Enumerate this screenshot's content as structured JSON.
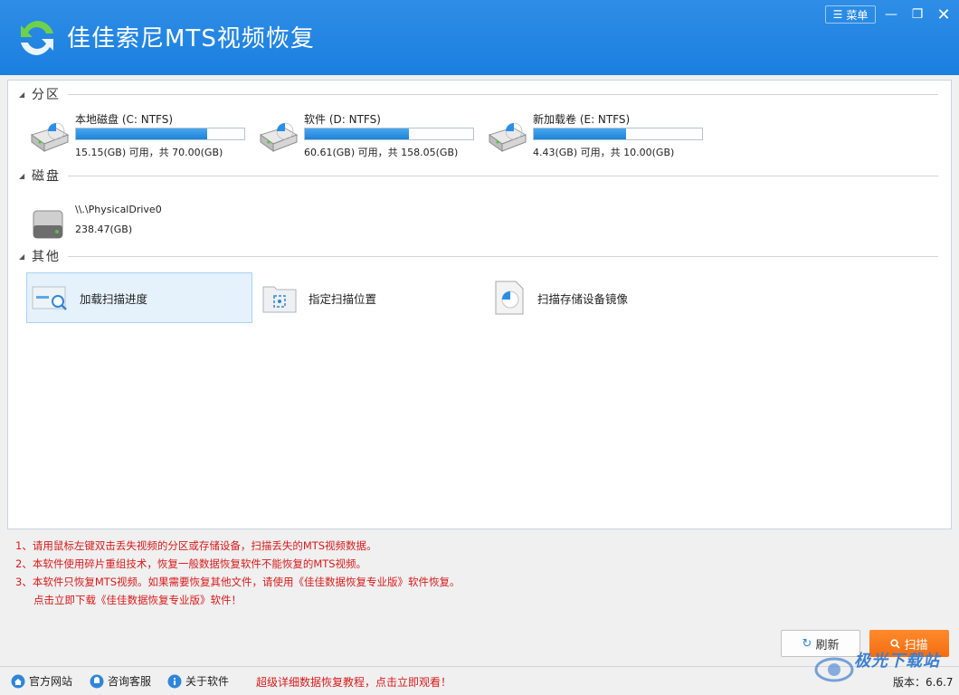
{
  "app": {
    "title": "佳佳索尼MTS视频恢复",
    "menu_label": "菜单",
    "accent": "#1b7fe0"
  },
  "sections": {
    "partition": "分区",
    "disk": "磁盘",
    "other": "其他"
  },
  "partitions": [
    {
      "name": "本地磁盘 (C: NTFS)",
      "info": "15.15(GB) 可用，共 70.00(GB)",
      "used_fraction": 0.78
    },
    {
      "name": "软件 (D: NTFS)",
      "info": "60.61(GB) 可用，共 158.05(GB)",
      "used_fraction": 0.62
    },
    {
      "name": "新加载卷 (E: NTFS)",
      "info": "4.43(GB) 可用，共 10.00(GB)",
      "used_fraction": 0.55
    }
  ],
  "disks": [
    {
      "name": "\\\\.\\PhysicalDrive0",
      "size": "238.47(GB)"
    }
  ],
  "others": [
    {
      "label": "加载扫描进度",
      "icon": "load-scan-progress-icon",
      "selected": true
    },
    {
      "label": "指定扫描位置",
      "icon": "folder-scan-icon",
      "selected": false
    },
    {
      "label": "扫描存储设备镜像",
      "icon": "disk-image-icon",
      "selected": false
    }
  ],
  "tips": [
    "1、请用鼠标左键双击丢失视频的分区或存储设备，扫描丢失的MTS视频数据。",
    "2、本软件使用碎片重组技术，恢复一般数据恢复软件不能恢复的MTS视频。",
    "3、本软件只恢复MTS视频。如果需要恢复其他文件，请使用《佳佳数据恢复专业版》软件恢复。",
    "点击立即下载《佳佳数据恢复专业版》软件！"
  ],
  "buttons": {
    "refresh": "刷新",
    "scan": "扫描"
  },
  "statusbar": {
    "site": "官方网站",
    "service": "咨询客服",
    "about": "关于软件",
    "tutorial": "超级详细数据恢复教程，点击立即观看！",
    "version": "版本：6.6.7"
  },
  "watermark": "极光下载站"
}
